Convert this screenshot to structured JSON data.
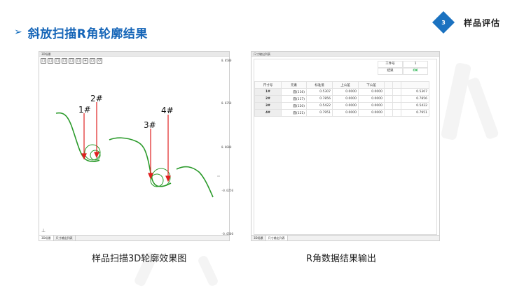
{
  "header": {
    "title_arrow": "➢",
    "title": "斜放扫描R角轮廓结果",
    "badge_number": "3",
    "section_label": "样品评估"
  },
  "colors": {
    "accent_blue": "#1565b8",
    "badge_blue": "#1b72c0",
    "curve_green": "#2a9a2a",
    "arrow_red": "#e02020",
    "ok_green": "#22b34a"
  },
  "view3d": {
    "window_title": "3D场景",
    "toolbar_icons": [
      "front-view-icon",
      "back-view-icon",
      "left-view-icon",
      "right-view-icon",
      "top-view-icon",
      "bottom-view-icon",
      "zoom-in-icon",
      "zoom-fit-icon",
      "reset-view-icon"
    ],
    "axis_ticks": [
      "0.0500",
      "0.0250",
      "0.0000",
      "-0.0250",
      "-0.0500"
    ],
    "markers": [
      "1#",
      "2#",
      "3#",
      "4#"
    ],
    "tabs": [
      "3D场景",
      "尺寸输出列表"
    ]
  },
  "results": {
    "window_title": "尺寸输出列表",
    "workpiece_label": "工件号",
    "workpiece_value": "1",
    "result_label": "结果",
    "result_value": "OK",
    "columns": [
      "尺寸号",
      "元素",
      "标准值",
      "上公差",
      "下公差",
      "",
      "",
      ""
    ],
    "rows": [
      [
        "1#",
        "圆(116)",
        "0.5307",
        "0.0000",
        "0.0000",
        "",
        "",
        "0.5307"
      ],
      [
        "2#",
        "圆(117)",
        "0.7856",
        "0.0000",
        "0.0000",
        "",
        "",
        "0.7856"
      ],
      [
        "3#",
        "圆(120)",
        "0.5422",
        "0.0000",
        "0.0000",
        "",
        "",
        "0.5422"
      ],
      [
        "4#",
        "圆(121)",
        "0.7951",
        "0.0000",
        "0.0000",
        "",
        "",
        "0.7951"
      ]
    ],
    "tabs": [
      "3D场景",
      "尺寸输出列表"
    ]
  },
  "captions": {
    "left": "样品扫描3D轮廓效果图",
    "right": "R角数据结果输出"
  }
}
